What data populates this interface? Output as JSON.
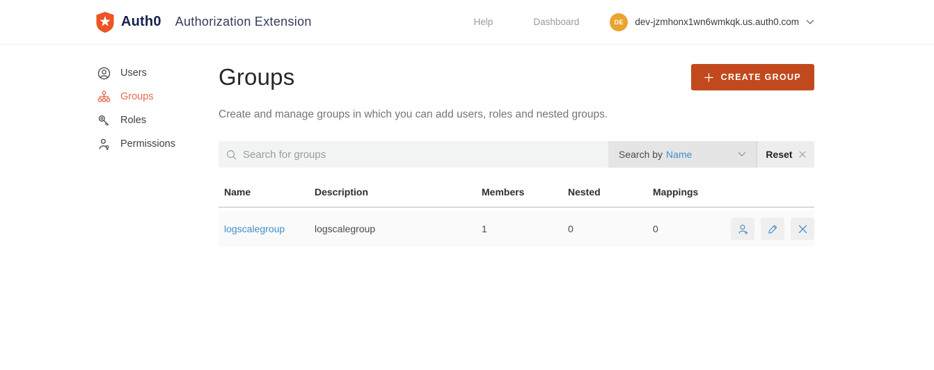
{
  "header": {
    "brand": "Auth0",
    "app_title": "Authorization Extension",
    "nav": [
      {
        "label": "Help"
      },
      {
        "label": "Dashboard"
      }
    ],
    "account": {
      "initials": "DE",
      "domain": "dev-jzmhonx1wn6wmkqk.us.auth0.com"
    }
  },
  "sidebar": {
    "items": [
      {
        "label": "Users",
        "icon": "user-circle-icon",
        "active": false
      },
      {
        "label": "Groups",
        "icon": "hierarchy-icon",
        "active": true
      },
      {
        "label": "Roles",
        "icon": "keys-icon",
        "active": false
      },
      {
        "label": "Permissions",
        "icon": "person-key-icon",
        "active": false
      }
    ]
  },
  "main": {
    "title": "Groups",
    "create_button_label": "CREATE GROUP",
    "description": "Create and manage groups in which you can add users, roles and nested groups.",
    "search": {
      "placeholder": "Search for groups",
      "filter_prefix": "Search by",
      "filter_value": "Name",
      "reset_label": "Reset"
    },
    "table": {
      "columns": [
        "Name",
        "Description",
        "Members",
        "Nested",
        "Mappings"
      ],
      "rows": [
        {
          "name": "logscalegroup",
          "description": "logscalegroup",
          "members": "1",
          "nested": "0",
          "mappings": "0",
          "actions": [
            "add-member-icon",
            "edit-icon",
            "delete-icon"
          ]
        }
      ]
    }
  },
  "colors": {
    "brand_orange": "#eb5424",
    "brand_navy": "#16214d",
    "accent_button": "#c2491d",
    "active_nav": "#e0694c",
    "link_blue": "#3e8fc9",
    "avatar_amber": "#e9a32f",
    "row_bg": "#fafafa",
    "input_bg": "#f2f3f3"
  }
}
